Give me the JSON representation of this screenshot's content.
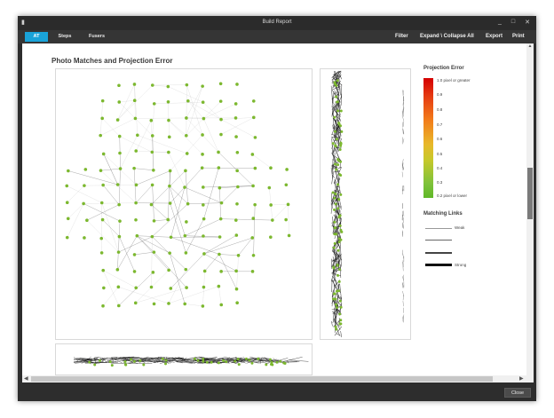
{
  "window": {
    "title": "Build Report",
    "controls": [
      "_",
      "□",
      "✕"
    ]
  },
  "toolbar": {
    "tabs": [
      {
        "label": "AT",
        "active": true
      },
      {
        "label": "Steps",
        "active": false
      },
      {
        "label": "Fusers",
        "active": false
      }
    ],
    "menu": [
      "Filter",
      "Expand \\ Collapse All",
      "Export",
      "Print"
    ]
  },
  "report": {
    "section_title": "Photo Matches and Projection Error"
  },
  "legend": {
    "projection_title": "Projection Error",
    "scale": [
      "1.0 pixel or greater",
      "0.9",
      "0.8",
      "0.7",
      "0.6",
      "0.5",
      "0.4",
      "0.3",
      "0.2 pixel or lower"
    ],
    "links_title": "Matching Links",
    "links": [
      "Weak",
      "",
      "",
      "Strong"
    ]
  },
  "footer": {
    "close_label": "Close"
  },
  "colors": {
    "accent": "#1aa3d9",
    "camera_point": "#7cb82f",
    "error_max": "#d40000",
    "error_min": "#5fb828"
  },
  "icons": {
    "app": "app-icon",
    "scroll_up": "chevron-up-icon",
    "scroll_down": "chevron-down-icon",
    "scroll_left": "chevron-left-icon",
    "scroll_right": "chevron-right-icon"
  }
}
